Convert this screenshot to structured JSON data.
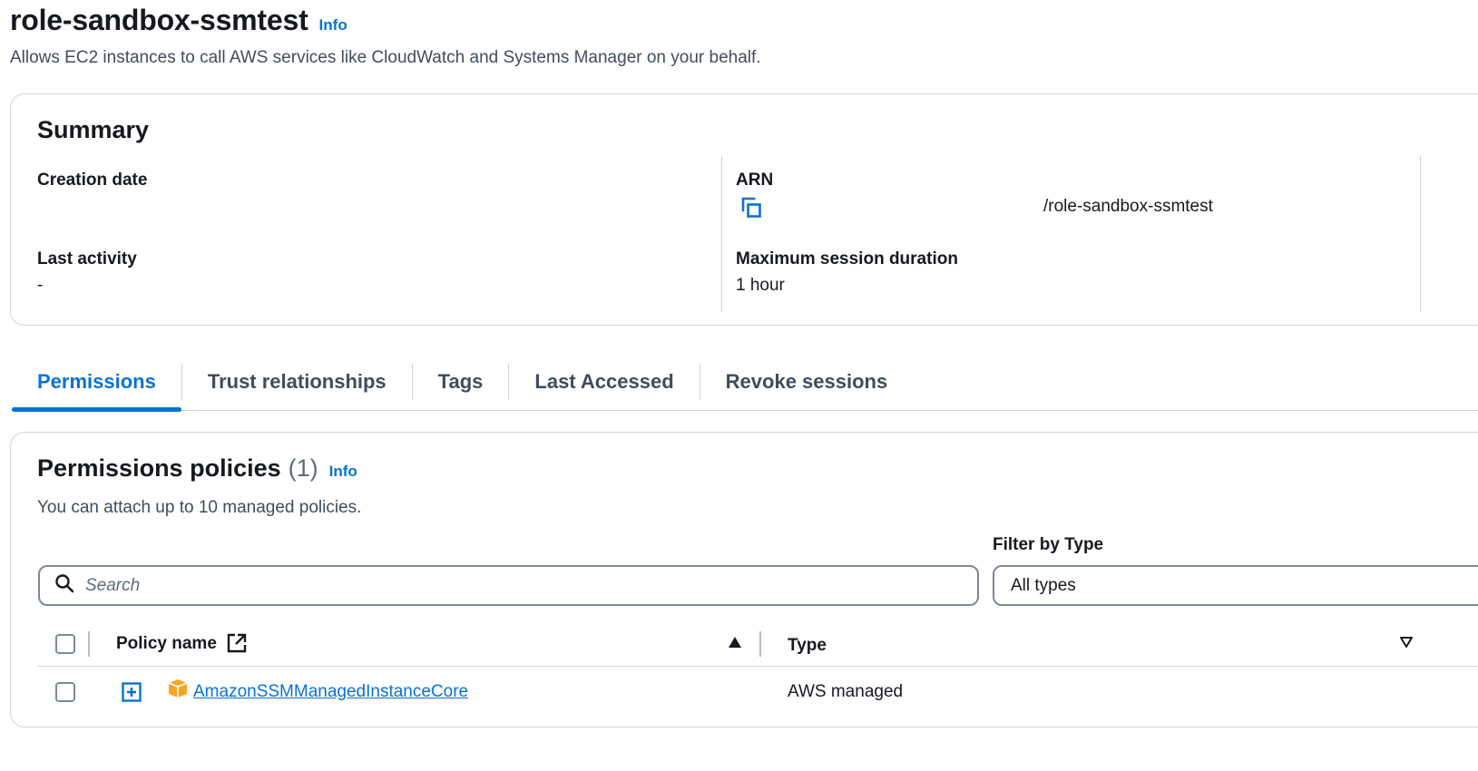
{
  "header": {
    "title": "role-sandbox-ssmtest",
    "info_label": "Info",
    "subtitle": "Allows EC2 instances to call AWS services like CloudWatch and Systems Manager on your behalf."
  },
  "summary": {
    "title": "Summary",
    "creation_date_label": "Creation date",
    "creation_date_value": "",
    "last_activity_label": "Last activity",
    "last_activity_value": "-",
    "arn_label": "ARN",
    "arn_value": "/role-sandbox-ssmtest",
    "max_session_label": "Maximum session duration",
    "max_session_value": "1 hour"
  },
  "tabs": [
    {
      "label": "Permissions",
      "active": true
    },
    {
      "label": "Trust relationships",
      "active": false
    },
    {
      "label": "Tags",
      "active": false
    },
    {
      "label": "Last Accessed",
      "active": false
    },
    {
      "label": "Revoke sessions",
      "active": false
    }
  ],
  "policies": {
    "title": "Permissions policies",
    "count": "(1)",
    "info_label": "Info",
    "description": "You can attach up to 10 managed policies.",
    "filter_label": "Filter by Type",
    "search_placeholder": "Search",
    "filter_value": "All types",
    "columns": {
      "policy_name": "Policy name",
      "type": "Type"
    },
    "rows": [
      {
        "name": "AmazonSSMManagedInstanceCore",
        "type": "AWS managed"
      }
    ]
  },
  "colors": {
    "accent": "#0972d3",
    "text": "#16191f",
    "border": "#d1d5db",
    "aws_icon": "#f5a623"
  },
  "icons": {
    "copy": "copy-icon",
    "search": "search-icon",
    "external_link": "external-link-icon",
    "sort_ascending": "sort-ascending-icon",
    "sort_descending": "sort-descending-icon",
    "expand": "expand-plus-icon",
    "aws_managed": "aws-managed-cube-icon"
  }
}
